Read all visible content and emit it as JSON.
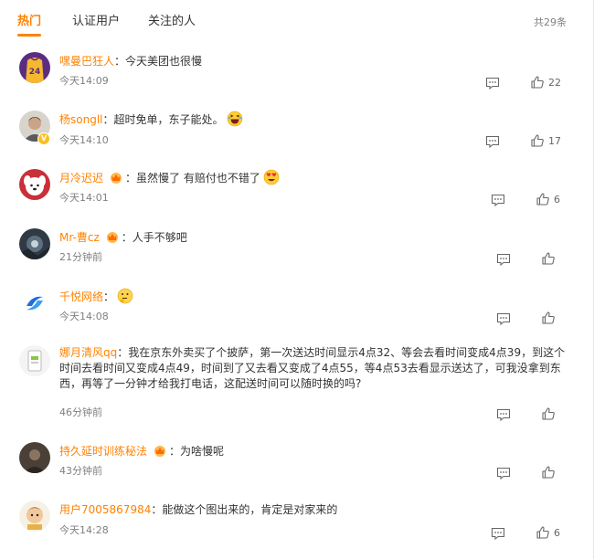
{
  "tabs": [
    {
      "label": "热门"
    },
    {
      "label": "认证用户"
    },
    {
      "label": "关注的人"
    }
  ],
  "total": "共29条",
  "separator": "：",
  "colors": {
    "accent": "#ff8200",
    "text": "#333333",
    "meta": "#808080"
  },
  "comments": [
    {
      "user": "嘿曼巴狂人",
      "text": "今天美团也很慢",
      "time": "今天14:09",
      "likes": "22",
      "avatar_icon": "lakers-jersey-avatar"
    },
    {
      "user": "杨songll",
      "text": "超时免单，东子能处。",
      "time": "今天14:10",
      "likes": "17",
      "avatar_icon": "portrait-avatar",
      "verified": true,
      "emoji": "laughing-emoji"
    },
    {
      "user": "月冷迟迟",
      "text": "虽然慢了 有赔付也不错了",
      "time": "今天14:01",
      "likes": "6",
      "avatar_icon": "cartoon-dog-avatar",
      "crown": true,
      "emoji": "heart-eyes-emoji"
    },
    {
      "user": "Mr-曹cz",
      "text": "人手不够吧",
      "time": "21分钟前",
      "likes": "",
      "avatar_icon": "dark-scene-avatar",
      "crown": true
    },
    {
      "user": "千悦网络",
      "text": "",
      "time": "今天14:08",
      "likes": "",
      "avatar_icon": "blue-logo-avatar",
      "emoji": "thinking-emoji"
    },
    {
      "user": "娜月清风qq",
      "text": "我在京东外卖买了个披萨，第一次送达时间显示4点32、等会去看时间变成4点39，到这个时间去看时间又变成4点49，时间到了又去看又变成了4点55，等4点53去看显示送达了，可我没拿到东西，再等了一分钟才给我打电话，这配送时间可以随时换的吗?",
      "time": "46分钟前",
      "likes": "",
      "avatar_icon": "product-avatar"
    },
    {
      "user": "持久延时训练秘法",
      "text": "为啥慢呢",
      "time": "43分钟前",
      "likes": "",
      "avatar_icon": "dark-photo-avatar",
      "crown": true
    },
    {
      "user": "用户7005867984",
      "text": "能做这个图出来的，肯定是对家来的",
      "time": "今天14:28",
      "likes": "6",
      "avatar_icon": "cartoon-boy-avatar"
    }
  ]
}
